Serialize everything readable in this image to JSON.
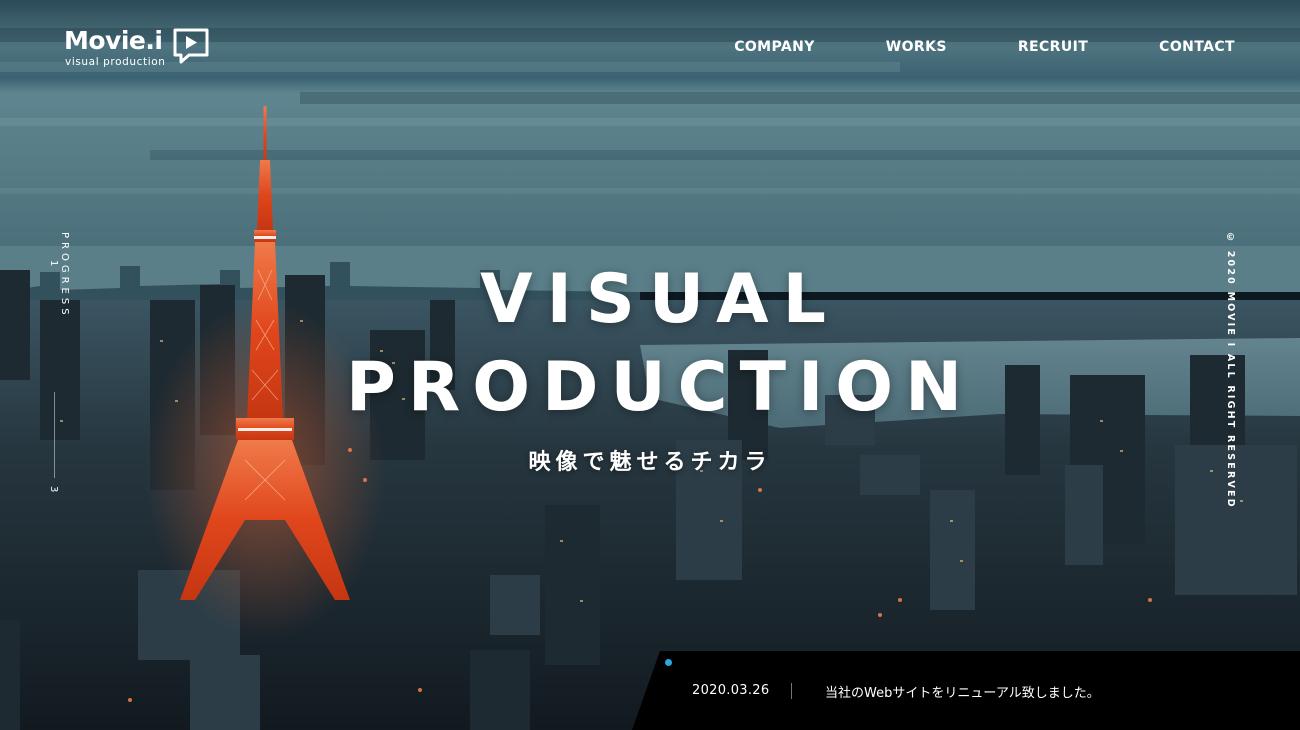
{
  "logo": {
    "name": "Movie.i",
    "tagline": "visual production"
  },
  "nav": {
    "items": [
      {
        "label": "COMPANY"
      },
      {
        "label": "WORKS"
      },
      {
        "label": "RECRUIT"
      },
      {
        "label": "CONTACT"
      }
    ]
  },
  "hero": {
    "title_line1": "VISUAL",
    "title_line2": "PRODUCTION",
    "subtitle": "映像で魅せるチカラ",
    "background_image": "tokyo-tower-city-dusk"
  },
  "progress": {
    "label": "PROGRESS",
    "current": "1",
    "total": "3"
  },
  "copyright": "© 2020 MOVIE I ALL RIGHT RESERVED",
  "news": {
    "date": "2020.03.26",
    "text": "当社のWebサイトをリニューアル致しました。"
  },
  "colors": {
    "accent_dot": "#2ea7e0",
    "news_bar": "#000000",
    "tower": "#e0461c",
    "sky": "#2f5664"
  },
  "icons": {
    "logo_icon": "play-speech-bubble-icon"
  }
}
